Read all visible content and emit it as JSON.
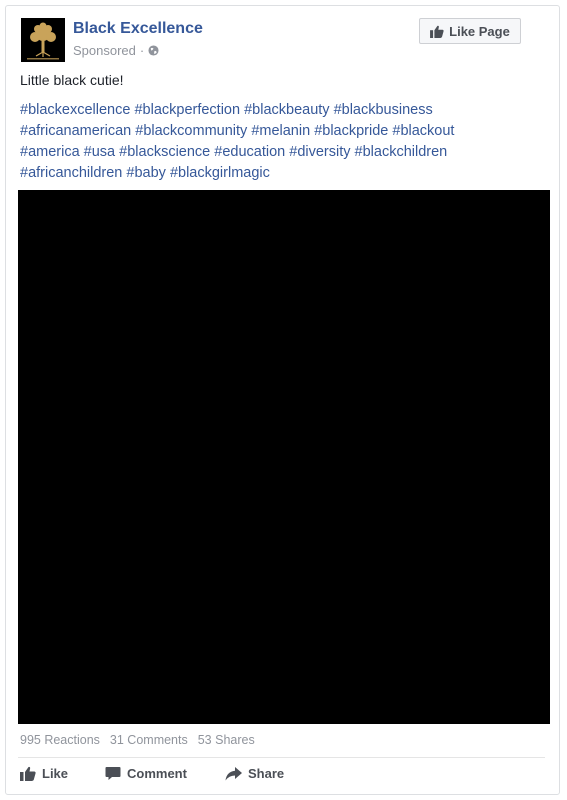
{
  "post": {
    "page_name": "Black Excellence",
    "sponsored_label": "Sponsored",
    "separator": "·",
    "like_page_label": "Like Page",
    "text": "Little black cutie!",
    "hashtags": [
      "#blackexcellence",
      "#blackperfection",
      "#blackbeauty",
      "#blackbusiness",
      "#africanamerican",
      "#blackcommunity",
      "#melanin",
      "#blackpride",
      "#blackout",
      "#america",
      "#usa",
      "#blackscience",
      "#education",
      "#diversity",
      "#blackchildren",
      "#africanchildren",
      "#baby",
      "#blackgirlmagic"
    ]
  },
  "stats": {
    "reactions": "995 Reactions",
    "comments": "31 Comments",
    "shares": "53 Shares"
  },
  "actions": {
    "like_label": "Like",
    "comment_label": "Comment",
    "share_label": "Share"
  },
  "icons": {
    "avatar": "tree-logo",
    "privacy": "globe-icon",
    "like": "thumbs-up-icon",
    "comment": "comment-bubble-icon",
    "share": "share-arrow-icon"
  },
  "colors": {
    "link": "#365899",
    "meta": "#90949c",
    "action_text": "#4b4f56",
    "video_background": "#000000"
  }
}
